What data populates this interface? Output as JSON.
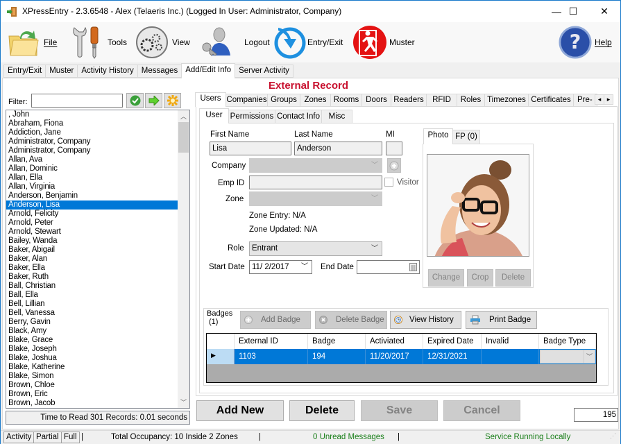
{
  "window": {
    "title": "XPressEntry - 2.3.6548 - Alex (Telaeris Inc.) (Logged In User: Administrator, Company)",
    "minimize": "—",
    "maximize": "☐",
    "close": "✕"
  },
  "toolbar": {
    "items": [
      {
        "label": "File",
        "icon": "folder-icon"
      },
      {
        "label": "Tools",
        "icon": "tools-icon"
      },
      {
        "label": "View",
        "icon": "gears-icon"
      },
      {
        "label": "Logout",
        "icon": "logout-user-key-icon"
      },
      {
        "label": "Entry/Exit",
        "icon": "entry-exit-arrow-icon"
      },
      {
        "label": "Muster",
        "icon": "emergency-exit-icon"
      },
      {
        "label": "Help",
        "icon": "help-icon"
      }
    ]
  },
  "main_tabs": [
    {
      "label": "Entry/Exit",
      "active": false
    },
    {
      "label": "Muster",
      "active": false
    },
    {
      "label": "Activity History",
      "active": false
    },
    {
      "label": "Messages",
      "active": false
    },
    {
      "label": "Add/Edit Info",
      "active": true
    },
    {
      "label": "Server Activity",
      "active": false
    }
  ],
  "filter": {
    "label": "Filter:",
    "value": "",
    "buttons": [
      "apply-filter-icon",
      "go-arrow-icon",
      "clear-filter-icon"
    ]
  },
  "user_list": {
    "selected": "Anderson, Lisa",
    "items": [
      ", John",
      "Abraham, Fiona",
      "Addiction, Jane",
      "Administrator, Company",
      "Administrator, Company",
      "Allan, Ava",
      "Allan, Dominic",
      "Allan, Ella",
      "Allan, Virginia",
      "Anderson, Benjamin",
      "Anderson, Lisa",
      "Arnold, Felicity",
      "Arnold, Peter",
      "Arnold, Stewart",
      "Bailey, Wanda",
      "Baker, Abigail",
      "Baker, Alan",
      "Baker, Ella",
      "Baker, Ruth",
      "Ball, Christian",
      "Ball, Ella",
      "Bell, Lillian",
      "Bell, Vanessa",
      "Berry, Gavin",
      "Black, Amy",
      "Blake, Grace",
      "Blake, Joseph",
      "Blake, Joshua",
      "Blake, Katherine",
      "Blake, Simon",
      "Brown, Chloe",
      "Brown, Eric",
      "Brown, Jacob"
    ],
    "status": "Time to Read 301 Records: 0.01 seconds"
  },
  "record_title": "External Record",
  "top_tabs": [
    {
      "label": "Users",
      "active": true
    },
    {
      "label": "Companies"
    },
    {
      "label": "Groups"
    },
    {
      "label": "Zones"
    },
    {
      "label": "Rooms"
    },
    {
      "label": "Doors"
    },
    {
      "label": "Readers"
    },
    {
      "label": "RFID"
    },
    {
      "label": "Roles"
    },
    {
      "label": "Timezones"
    },
    {
      "label": "Certificates"
    },
    {
      "label": "Pre-F"
    }
  ],
  "tab_scroll": {
    "left": "◂",
    "right": "▸"
  },
  "user_tabs": [
    {
      "label": "User",
      "active": true
    },
    {
      "label": "Permissions"
    },
    {
      "label": "Contact Info"
    },
    {
      "label": "Misc"
    }
  ],
  "user_form": {
    "first_name_label": "First Name",
    "first_name": "Lisa",
    "last_name_label": "Last Name",
    "last_name": "Anderson",
    "mi_label": "MI",
    "mi": "",
    "company_label": "Company",
    "company": "",
    "emp_id_label": "Emp ID",
    "emp_id": "",
    "visitor_label": "Visitor",
    "visitor_checked": false,
    "zone_label": "Zone",
    "zone": "",
    "zone_entry": "Zone Entry: N/A",
    "zone_updated": "Zone Updated: N/A",
    "role_label": "Role",
    "role": "Entrant",
    "start_date_label": "Start Date",
    "start_date": "11/ 2/2017",
    "end_date_label": "End Date",
    "end_date": ""
  },
  "photo": {
    "tabs": [
      {
        "label": "Photo",
        "active": true
      },
      {
        "label": "FP (0)"
      }
    ],
    "buttons": [
      "Change",
      "Crop",
      "Delete"
    ]
  },
  "badges": {
    "label": "Badges",
    "count": "(1)",
    "buttons": {
      "add": "Add Badge",
      "delete": "Delete Badge",
      "history": "View History",
      "print": "Print Badge"
    },
    "columns": [
      "External ID",
      "Badge",
      "Activiated",
      "Expired Date",
      "Invalid",
      "Badge Type"
    ],
    "rows": [
      {
        "external_id": "1103",
        "badge": "194",
        "activated": "11/20/2017",
        "expired": "12/31/2021",
        "invalid": "",
        "badge_type": ""
      }
    ]
  },
  "actions": {
    "add_new": "Add New",
    "delete": "Delete",
    "save": "Save",
    "cancel": "Cancel",
    "record_number": "195"
  },
  "statusbar": {
    "buttons": [
      "Activity",
      "Partial",
      "Full"
    ],
    "occupancy": "Total Occupancy: 10 Inside 2 Zones",
    "messages": "0 Unread Messages",
    "service": "Service Running Locally",
    "separator": "|"
  },
  "colors": {
    "accent": "#0078d7",
    "record_title": "#c8102e",
    "status_green": "#1a7f1a"
  }
}
